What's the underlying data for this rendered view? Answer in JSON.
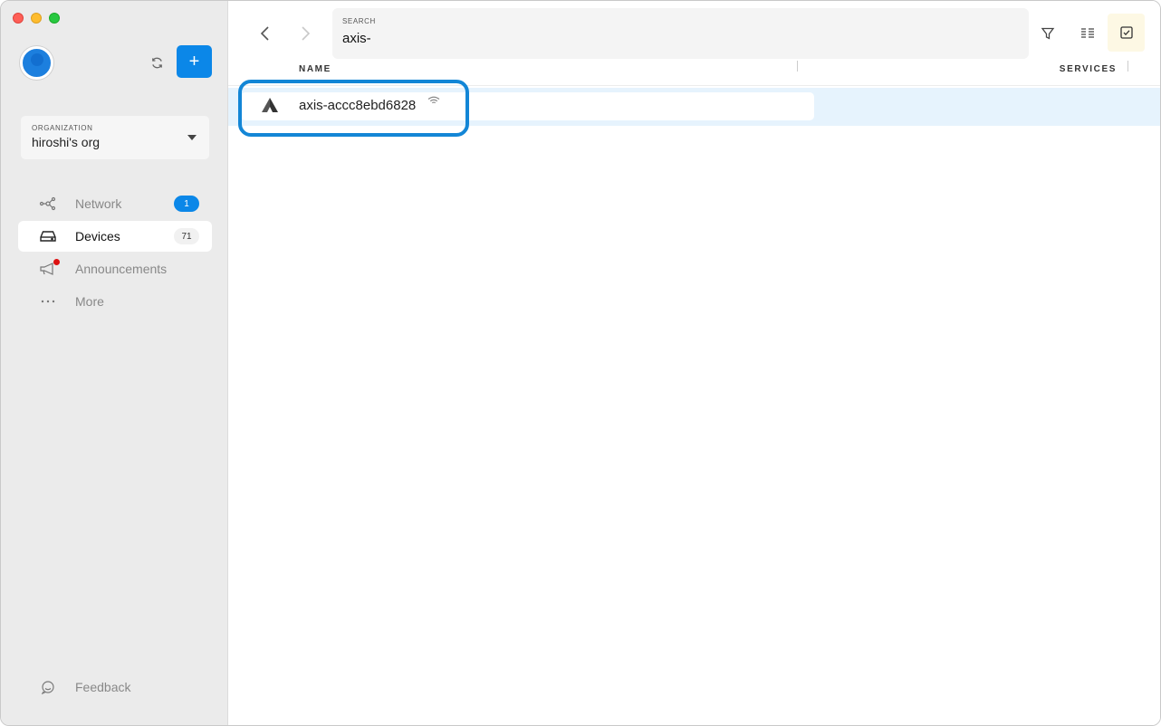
{
  "sidebar": {
    "organization": {
      "label": "ORGANIZATION",
      "value": "hiroshi's org"
    },
    "items": [
      {
        "label": "Network",
        "icon": "network-icon",
        "badge": "1",
        "badge_style": "blue"
      },
      {
        "label": "Devices",
        "icon": "drive-icon",
        "badge": "71",
        "badge_style": "grey",
        "active": true
      },
      {
        "label": "Announcements",
        "icon": "megaphone-icon"
      },
      {
        "label": "More",
        "icon": "more-dots-icon"
      }
    ],
    "feedback_label": "Feedback"
  },
  "search": {
    "label": "SEARCH",
    "value": "axis-"
  },
  "columns": {
    "name": "NAME",
    "services": "SERVICES"
  },
  "rows": [
    {
      "name": "axis-accc8ebd6828",
      "icon": "axis-logo-icon",
      "status_icon": "wifi-icon"
    }
  ],
  "colors": {
    "accent": "#0b87e8",
    "highlight": "#1386d6",
    "row_selected": "#e6f3fd"
  }
}
